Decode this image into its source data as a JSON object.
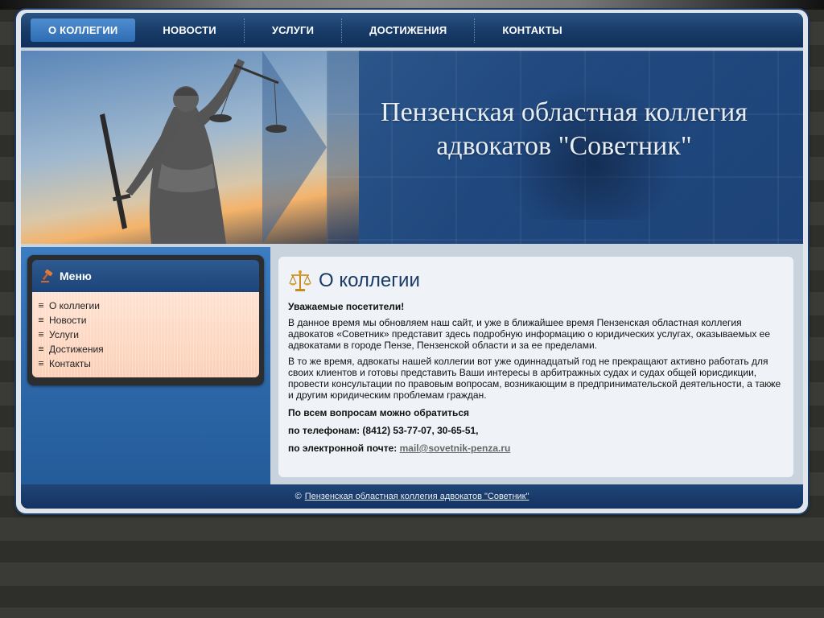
{
  "nav": {
    "items": [
      {
        "label": "О КОЛЛЕГИИ",
        "active": true
      },
      {
        "label": "НОВОСТИ",
        "active": false
      },
      {
        "label": "УСЛУГИ",
        "active": false
      },
      {
        "label": "ДОСТИЖЕНИЯ",
        "active": false
      },
      {
        "label": "КОНТАКТЫ",
        "active": false
      }
    ]
  },
  "header": {
    "title_line1": "Пензенская областная коллегия",
    "title_line2": "адвокатов \"Советник\""
  },
  "sidebar": {
    "menu_title": "Меню",
    "menu_icon": "gavel-icon",
    "items": [
      {
        "label": "О коллегии"
      },
      {
        "label": "Новости"
      },
      {
        "label": "Услуги"
      },
      {
        "label": "Достижения"
      },
      {
        "label": "Контакты"
      }
    ]
  },
  "main": {
    "title": "О коллегии",
    "title_icon": "scales-icon",
    "greeting": "Уважаемые посетители!",
    "paragraph1": "В данное время мы обновляем наш сайт, и уже в ближайшее время Пензенская областная коллегия адвокатов «Советник» представит здесь подробную информацию о юридических услугах, оказываемых ее адвокатами в городе Пензе, Пензенской области и за ее пределами.",
    "paragraph2": "В то же время, адвокаты нашей коллегии вот уже одиннадцатый год не прекращают активно работать для своих клиентов и готовы представить Ваши интересы в арбитражных судах и судах общей юрисдикции, провести консультации по правовым вопросам, возникающим в предпринимательской деятельности, а также и другим юридическим проблемам граждан.",
    "contact_heading": "По всем вопросам можно обратиться",
    "phone_label": "по телефонам: (8412) 53-77-07, 30-65-51,",
    "email_label": "по электронной почте:",
    "email": "mail@sovetnik-penza.ru"
  },
  "footer": {
    "copyright": "©",
    "link_text": "Пензенская областная коллегия адвокатов \"Советник\""
  },
  "colors": {
    "nav_active": "#3e7ec4",
    "brand_dark_blue": "#1b3b66",
    "sidebar_blue": "#2c66a6",
    "menu_bg": "#fcd8c4"
  }
}
